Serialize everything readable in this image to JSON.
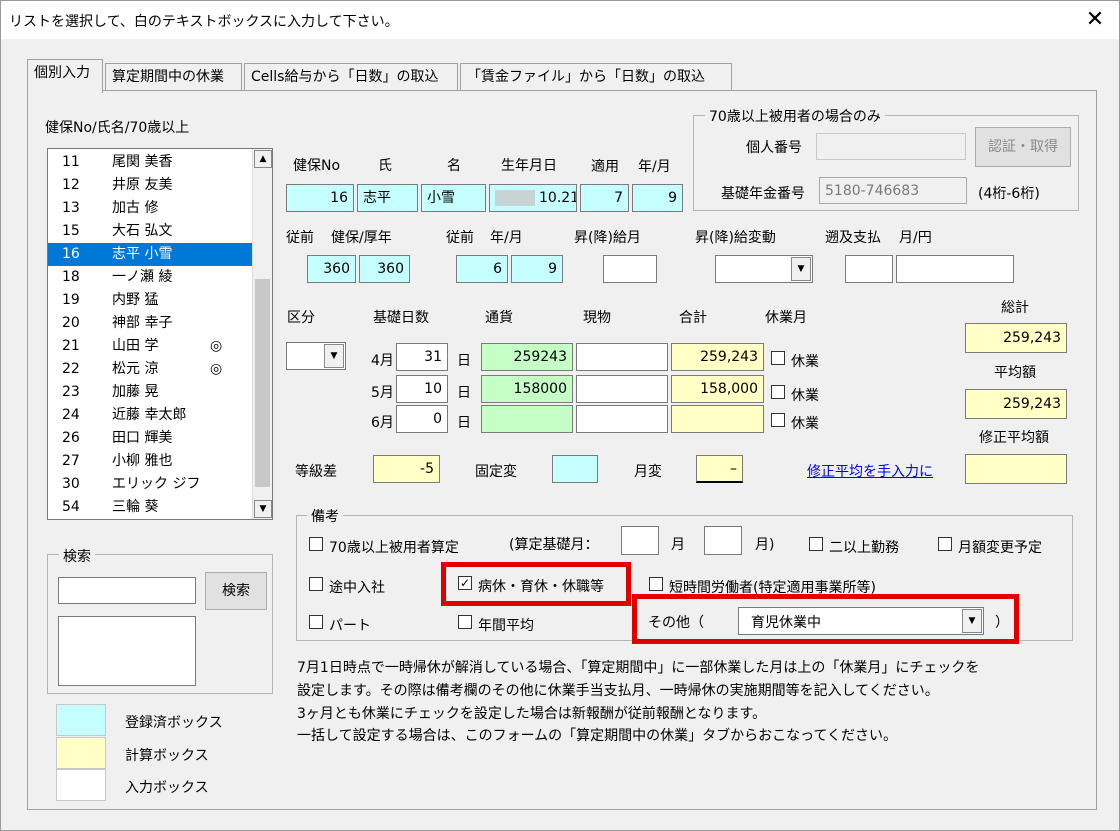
{
  "window": {
    "title": "リストを選択して、白のテキストボックスに入力して下さい。",
    "close_glyph": "✕"
  },
  "tabs": [
    {
      "label": "個別入力",
      "active": true
    },
    {
      "label": "算定期間中の休業"
    },
    {
      "label": "Cells給与から「日数」の取込"
    },
    {
      "label": "「賃金ファイル」から「日数」の取込"
    }
  ],
  "list": {
    "header": "健保No/氏名/70歳以上",
    "items": [
      {
        "no": "11",
        "name": "尾関 美香",
        "mark": ""
      },
      {
        "no": "12",
        "name": "井原 友美",
        "mark": ""
      },
      {
        "no": "13",
        "name": "加古 修",
        "mark": ""
      },
      {
        "no": "15",
        "name": "大石 弘文",
        "mark": ""
      },
      {
        "no": "16",
        "name": "志平 小雪",
        "mark": "",
        "selected": true
      },
      {
        "no": "18",
        "name": "一ノ瀬 綾",
        "mark": ""
      },
      {
        "no": "19",
        "name": "内野 猛",
        "mark": ""
      },
      {
        "no": "20",
        "name": "神部 幸子",
        "mark": ""
      },
      {
        "no": "21",
        "name": "山田 学",
        "mark": "◎"
      },
      {
        "no": "22",
        "name": "松元 涼",
        "mark": "◎"
      },
      {
        "no": "23",
        "name": "加藤 晃",
        "mark": ""
      },
      {
        "no": "24",
        "name": "近藤 幸太郎",
        "mark": ""
      },
      {
        "no": "26",
        "name": "田口 輝美",
        "mark": ""
      },
      {
        "no": "27",
        "name": "小柳 雅也",
        "mark": ""
      },
      {
        "no": "30",
        "name": "エリック ジフ",
        "mark": ""
      },
      {
        "no": "54",
        "name": "三輪 葵",
        "mark": ""
      }
    ]
  },
  "search": {
    "group_title": "検索",
    "button": "検索",
    "value": ""
  },
  "legend": [
    {
      "label": "登録済ボックス",
      "color": "#c6ffff"
    },
    {
      "label": "計算ボックス",
      "color": "#ffffc6"
    },
    {
      "label": "入力ボックス",
      "color": "#ffffff"
    }
  ],
  "over70": {
    "title": "70歳以上被用者の場合のみ",
    "personal_no_label": "個人番号",
    "personal_no_value": "",
    "auth_button": "認証・取得",
    "pension_no_label": "基礎年金番号",
    "pension_no_value": "5180-746683",
    "pension_hint": "(4桁-6桁)"
  },
  "employee": {
    "labels": {
      "no": "健保No",
      "last": "氏",
      "first": "名",
      "birth": "生年月日",
      "apply": "適用",
      "ym": "年/月"
    },
    "no": "16",
    "last": "志平",
    "first": "小雪",
    "birth": "10.21",
    "apply_y": "7",
    "apply_m": "9"
  },
  "previous": {
    "labels": {
      "prev": "従前",
      "kenpo": "健保/厚年",
      "prev2": "従前",
      "ym": "年/月",
      "raise_month": "昇(降)給月",
      "raise_change": "昇(降)給変動",
      "retro": "遡及支払",
      "ym_yen": "月/円"
    },
    "kenpo": "360",
    "kosei": "360",
    "year": "6",
    "month": "9",
    "raise_month": "",
    "raise_change": "",
    "retro_month": "",
    "retro_yen": ""
  },
  "pay": {
    "labels": {
      "kubun": "区分",
      "days": "基礎日数",
      "cash": "通貨",
      "goods": "現物",
      "total": "合計",
      "leave": "休業月",
      "grand_total": "総計",
      "average": "平均額",
      "adj_average": "修正平均額",
      "day_unit": "日",
      "leave_label": "休業"
    },
    "rows": [
      {
        "month": "4月",
        "days": "31",
        "cash": "259243",
        "goods": "",
        "total": "259,243"
      },
      {
        "month": "5月",
        "days": "10",
        "cash": "158000",
        "goods": "",
        "total": "158,000"
      },
      {
        "month": "6月",
        "days": "0",
        "cash": "",
        "goods": "",
        "total": ""
      }
    ],
    "grand_total": "259,243",
    "average": "259,243",
    "adj_average": ""
  },
  "grade": {
    "diff_label": "等級差",
    "diff": "-5",
    "fixed_label": "固定変",
    "fixed": "",
    "monthly_label": "月変",
    "monthly": "–",
    "manual_link": "修正平均を手入力に"
  },
  "remarks": {
    "title": "備考",
    "over70": "70歳以上被用者算定",
    "base_month_label": "(算定基礎月：",
    "month_unit": "月",
    "month_close": "月)",
    "multi_work": "二以上勤務",
    "monthly_change": "月額変更予定",
    "mid_join": "途中入社",
    "sick_leave": "病休・育休・休職等",
    "short_time": "短時間労働者(特定適用事業所等)",
    "part": "パート",
    "annual_avg": "年間平均",
    "other_label": "その他（",
    "other_value": "育児休業中",
    "other_close": "）"
  },
  "notes": [
    "7月1日時点で一時帰休が解消している場合、「算定期間中」に一部休業した月は上の「休業月」にチェックを",
    "設定します。その際は備考欄のその他に休業手当支払月、一時帰休の実施期間等を記入してください。",
    "3ヶ月とも休業にチェックを設定した場合は新報酬が従前報酬となります。",
    "一括して設定する場合は、このフォームの「算定期間中の休業」タブからおこなってください。"
  ]
}
